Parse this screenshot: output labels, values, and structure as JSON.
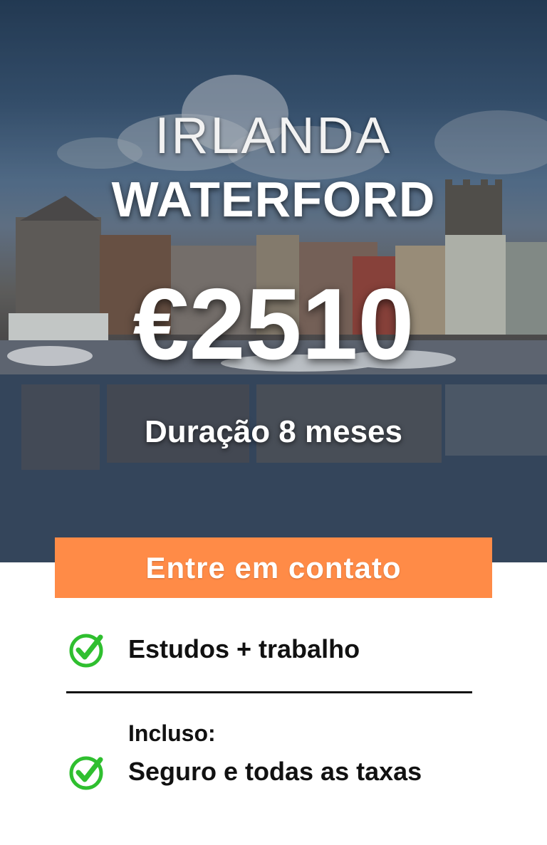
{
  "hero": {
    "country": "IRLANDA",
    "city": "WATERFORD",
    "price": "€2510",
    "duration": "Duração 8 meses"
  },
  "cta": {
    "label": "Entre em contato",
    "color": "#ff8b47"
  },
  "features": {
    "primary": "Estudos + trabalho",
    "included_label": "Incluso:",
    "included_item": "Seguro e todas as taxas",
    "check_color": "#2fbf2f",
    "check_icon": "check-circle-icon"
  }
}
